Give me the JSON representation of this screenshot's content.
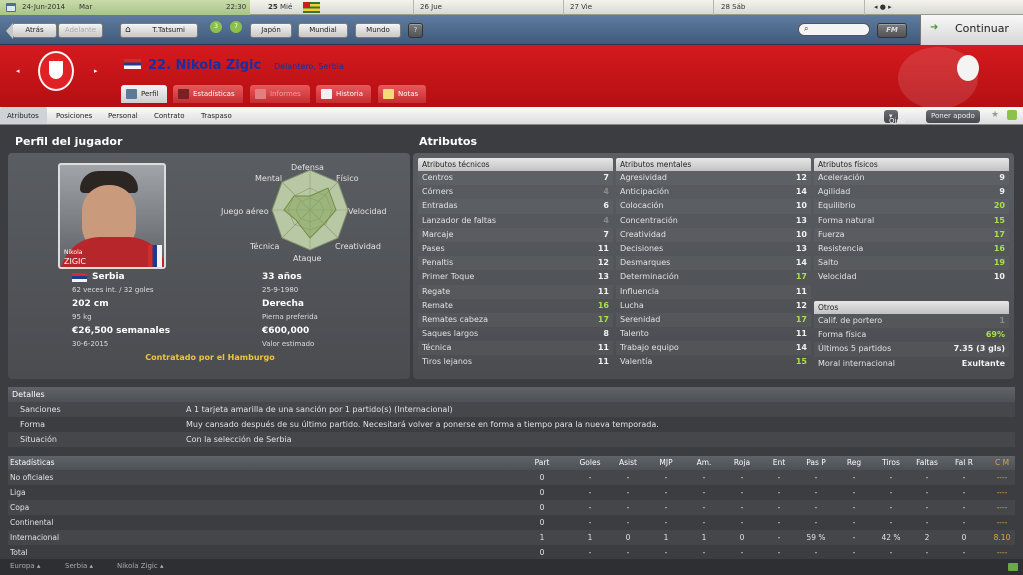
{
  "calendar": {
    "date": "24-Jun-2014",
    "weekday": "Mar",
    "time": "22:30",
    "days": [
      {
        "num": "25",
        "name": "Mié"
      },
      {
        "num": "26",
        "name": "Jue"
      },
      {
        "num": "27",
        "name": "Vie"
      },
      {
        "num": "28",
        "name": "Sáb"
      }
    ]
  },
  "toolbar": {
    "back": "Atrás",
    "forward": "Adelante",
    "manager": "T.Tatsumi",
    "badge1": "3",
    "badge2": "7",
    "menus": [
      "Japón",
      "Mundial",
      "Mundo"
    ],
    "help": "?",
    "fm": "FM",
    "continue": "Continuar"
  },
  "player": {
    "number_name": "22. Nikola Zigic",
    "position_club": "Delantero, Serbia",
    "photo_name_first": "Nikola",
    "photo_name_last": "ZIGIC"
  },
  "tabs": [
    {
      "label": "Perfil",
      "active": true
    },
    {
      "label": "Estadísticas"
    },
    {
      "label": "Informes"
    },
    {
      "label": "Historia"
    },
    {
      "label": "Notas"
    }
  ],
  "subnav": {
    "items": [
      "Atributos",
      "Posiciones",
      "Personal",
      "Contrato",
      "Traspaso"
    ],
    "eye": "Ojeo",
    "watch": "Poner apodo"
  },
  "profile": {
    "title": "Perfil del jugador",
    "radar_labels": {
      "top": "Defensa",
      "tl": "Mental",
      "tr": "Físico",
      "l": "Juego aéreo",
      "r": "Velocidad",
      "bl": "Técnica",
      "br": "Creatividad",
      "bottom": "Ataque"
    },
    "nation": "Serbia",
    "caps": "62 veces int. / 32 goles",
    "age": "33 años",
    "dob": "25-9-1980",
    "height": "202 cm",
    "weight": "95 kg",
    "foot": "Derecha",
    "foot_label": "Pierna preferida",
    "wage": "€26,500 semanales",
    "contract_end": "30-6-2015",
    "value": "€600,000",
    "value_label": "Valor estimado",
    "contract_note": "Contratado por el Hamburgo"
  },
  "attributes": {
    "title": "Atributos",
    "technical": {
      "label": "Atributos técnicos",
      "items": [
        [
          "Centros",
          "7"
        ],
        [
          "Córners",
          "4"
        ],
        [
          "Entradas",
          "6"
        ],
        [
          "Lanzador de faltas",
          "4"
        ],
        [
          "Marcaje",
          "7"
        ],
        [
          "Pases",
          "11"
        ],
        [
          "Penaltis",
          "12"
        ],
        [
          "Primer Toque",
          "13"
        ],
        [
          "Regate",
          "11"
        ],
        [
          "Remate",
          "16"
        ],
        [
          "Remates cabeza",
          "17"
        ],
        [
          "Saques largos",
          "8"
        ],
        [
          "Técnica",
          "11"
        ],
        [
          "Tiros lejanos",
          "11"
        ]
      ]
    },
    "mental": {
      "label": "Atributos mentales",
      "items": [
        [
          "Agresividad",
          "12"
        ],
        [
          "Anticipación",
          "14"
        ],
        [
          "Colocación",
          "10"
        ],
        [
          "Concentración",
          "13"
        ],
        [
          "Creatividad",
          "10"
        ],
        [
          "Decisiones",
          "13"
        ],
        [
          "Desmarques",
          "14"
        ],
        [
          "Determinación",
          "17"
        ],
        [
          "Influencia",
          "11"
        ],
        [
          "Lucha",
          "12"
        ],
        [
          "Serenidad",
          "17"
        ],
        [
          "Talento",
          "11"
        ],
        [
          "Trabajo equipo",
          "14"
        ],
        [
          "Valentía",
          "15"
        ]
      ]
    },
    "physical": {
      "label": "Atributos físicos",
      "items": [
        [
          "Aceleración",
          "9"
        ],
        [
          "Agilidad",
          "9"
        ],
        [
          "Equilibrio",
          "20"
        ],
        [
          "Forma natural",
          "15"
        ],
        [
          "Fuerza",
          "17"
        ],
        [
          "Resistencia",
          "16"
        ],
        [
          "Salto",
          "19"
        ],
        [
          "Velocidad",
          "10"
        ]
      ]
    },
    "others": {
      "label": "Otros",
      "items": [
        [
          "Calif. de portero",
          "1"
        ],
        [
          "Forma física",
          "69%"
        ],
        [
          "Últimos 5 partidos",
          "7.35 (3 gls)"
        ],
        [
          "Moral internacional",
          "Exultante"
        ]
      ]
    }
  },
  "details": {
    "title": "Detalles",
    "rows": [
      [
        "Sanciones",
        "A 1 tarjeta amarilla de una sanción por 1 partido(s) (Internacional)"
      ],
      [
        "Forma",
        "Muy cansado después de su último partido. Necesitará volver a ponerse en forma a tiempo para la nueva temporada."
      ],
      [
        "Situación",
        "Con la selección de Serbia"
      ]
    ]
  },
  "stats": {
    "title": "Estadísticas",
    "cols": [
      "Part",
      "Goles",
      "Asist",
      "MJP",
      "Am.",
      "Roja",
      "Ent",
      "Pas P",
      "Reg",
      "Tiros",
      "Faltas",
      "Fal R",
      "C M"
    ],
    "rows": [
      [
        "No oficiales",
        "0",
        "-",
        "-",
        "-",
        "-",
        "-",
        "-",
        "-",
        "-",
        "-",
        "-",
        "-",
        "----"
      ],
      [
        "Liga",
        "0",
        "-",
        "-",
        "-",
        "-",
        "-",
        "-",
        "-",
        "-",
        "-",
        "-",
        "-",
        "----"
      ],
      [
        "Copa",
        "0",
        "-",
        "-",
        "-",
        "-",
        "-",
        "-",
        "-",
        "-",
        "-",
        "-",
        "-",
        "----"
      ],
      [
        "Continental",
        "0",
        "-",
        "-",
        "-",
        "-",
        "-",
        "-",
        "-",
        "-",
        "-",
        "-",
        "-",
        "----"
      ],
      [
        "Internacional",
        "1",
        "1",
        "0",
        "1",
        "1",
        "0",
        "-",
        "59 %",
        "-",
        "42 %",
        "2",
        "0",
        "8.10"
      ],
      [
        "Total",
        "0",
        "-",
        "-",
        "-",
        "-",
        "-",
        "-",
        "-",
        "-",
        "-",
        "-",
        "-",
        "----"
      ]
    ]
  },
  "footer": [
    "Europa",
    "Serbia",
    "Nikola Zigic"
  ]
}
